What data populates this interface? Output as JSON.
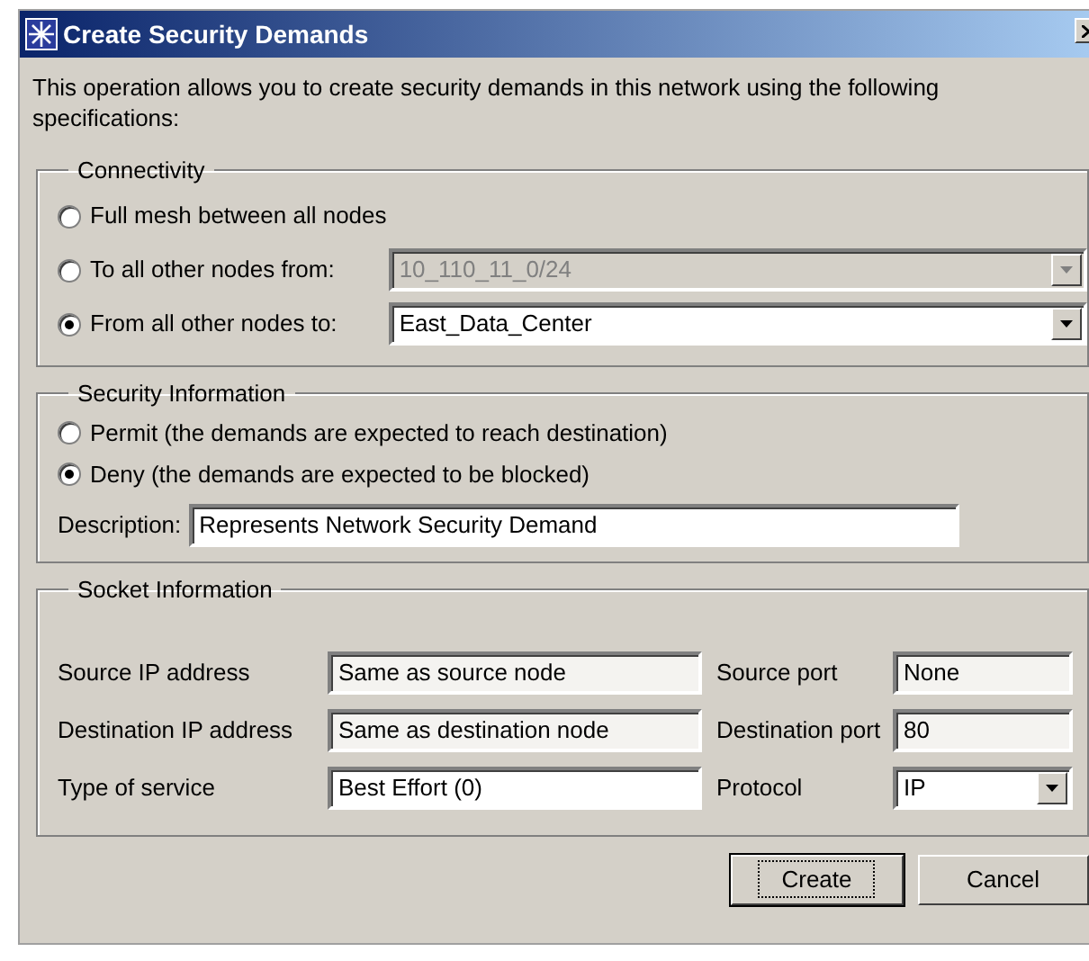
{
  "window": {
    "title": "Create Security Demands"
  },
  "intro": "This operation allows you to create security demands in this network using the following specifications:",
  "connectivity": {
    "legend": "Connectivity",
    "options": [
      {
        "label": "Full mesh between all nodes",
        "selected": false
      },
      {
        "label": "To all other nodes from:",
        "selected": false,
        "dropdown": {
          "value": "10_110_11_0/24",
          "disabled": true
        }
      },
      {
        "label": "From all other nodes to:",
        "selected": true,
        "dropdown": {
          "value": "East_Data_Center",
          "disabled": false
        }
      }
    ]
  },
  "security": {
    "legend": "Security Information",
    "options": [
      {
        "label": "Permit (the demands are expected to reach destination)",
        "selected": false
      },
      {
        "label": "Deny (the demands are expected to be blocked)",
        "selected": true
      }
    ],
    "description": {
      "label": "Description:",
      "value": "Represents Network Security Demand"
    }
  },
  "socket": {
    "legend": "Socket Information",
    "rows": [
      [
        {
          "label": "Source IP address",
          "value": "Same as source node",
          "kind": "readonly"
        },
        {
          "label": "Source port",
          "value": "None",
          "kind": "readonly"
        }
      ],
      [
        {
          "label": "Destination IP address",
          "value": "Same as destination node",
          "kind": "readonly"
        },
        {
          "label": "Destination port",
          "value": "80",
          "kind": "readonly"
        }
      ],
      [
        {
          "label": "Type of service",
          "value": "Best Effort (0)",
          "kind": "text"
        },
        {
          "label": "Protocol",
          "value": "IP",
          "kind": "dropdown"
        }
      ]
    ]
  },
  "buttons": [
    {
      "label": "Create",
      "default": true
    },
    {
      "label": "Cancel",
      "default": false
    }
  ]
}
